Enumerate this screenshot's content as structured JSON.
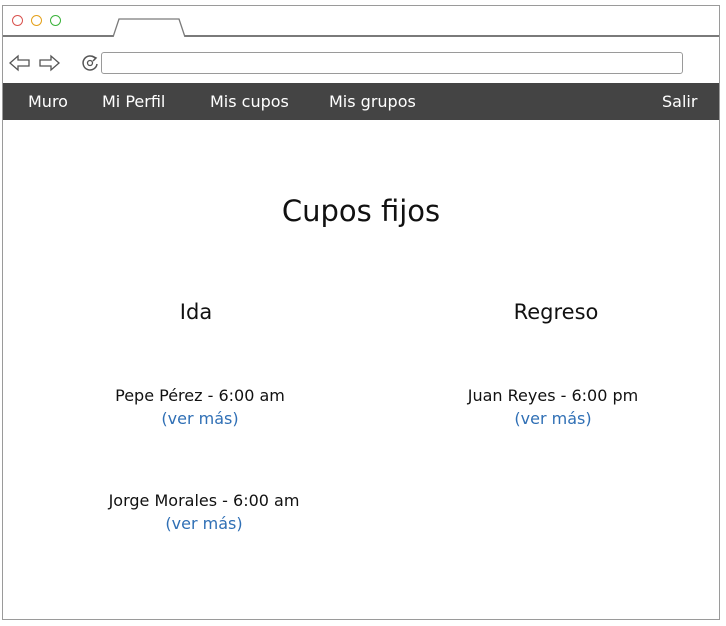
{
  "window": {
    "controls": [
      "close-icon",
      "minimize-icon",
      "maximize-icon"
    ]
  },
  "address_bar": {
    "url": ""
  },
  "menu": {
    "items": [
      {
        "label": "Muro"
      },
      {
        "label": "Mi Perfil"
      },
      {
        "label": "Mis cupos"
      },
      {
        "label": "Mis grupos"
      }
    ],
    "logout": "Salir",
    "background": "#444444"
  },
  "page": {
    "title": "Cupos fijos",
    "ida": {
      "heading": "Ida",
      "entries": [
        {
          "text": "Pepe Pérez - 6:00 am",
          "link": "(ver más)"
        },
        {
          "text": "Jorge Morales - 6:00 am",
          "link": "(ver más)"
        }
      ]
    },
    "regreso": {
      "heading": "Regreso",
      "entries": [
        {
          "text": "Juan Reyes - 6:00 pm",
          "link": "(ver más)"
        }
      ]
    },
    "link_color": "#2f6fb5"
  }
}
